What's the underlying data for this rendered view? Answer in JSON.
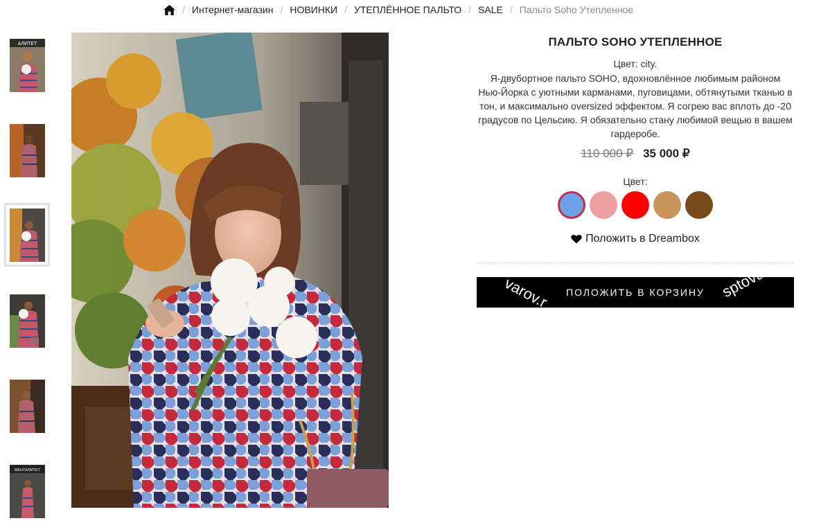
{
  "breadcrumb": {
    "items": [
      "Интернет-магазин",
      "НОВИНКИ",
      "УТЕПЛЁННОЕ ПАЛЬТО",
      "SALE"
    ],
    "current": "Пальто Soho Утепленное"
  },
  "thumbnails": {
    "count": 6,
    "active_index": 2,
    "first_caption": "АЛИТЕТ",
    "last_caption": "МЕНТАЛИТЕТ"
  },
  "product": {
    "title": "ПАЛЬТО SOHO УТЕПЛЕННОЕ",
    "color_line": "Цвет: city.",
    "description": "Я-двубортное пальто SOHO, вдохновлённое любимым районом Нью-Йорка с уютными карманами, пуговицами, обтянутыми тканью в тон, и максимально oversized эффектом. Я согрею вас вплоть до -20 градусов по Цельсию. Я обязательно стану любимой вещью в вашем гардеробе.",
    "old_price": "110 000 ₽",
    "new_price": "35 000 ₽",
    "swatch_label": "Цвет:",
    "swatches": [
      {
        "color": "#6fa1e8",
        "selected": true
      },
      {
        "color": "#ec9ea1",
        "selected": false
      },
      {
        "color": "#ff0000",
        "selected": false
      },
      {
        "color": "#c8955c",
        "selected": false
      },
      {
        "color": "#7a4b1a",
        "selected": false
      }
    ],
    "dreambox_label": "Положить в Dreambox",
    "cart_label": "ПОЛОЖИТЬ В КОРЗИНУ",
    "watermark_left": "varov.r",
    "watermark_right": "sptovar"
  },
  "icons": {
    "home": "home-icon",
    "heart": "heart-icon"
  }
}
